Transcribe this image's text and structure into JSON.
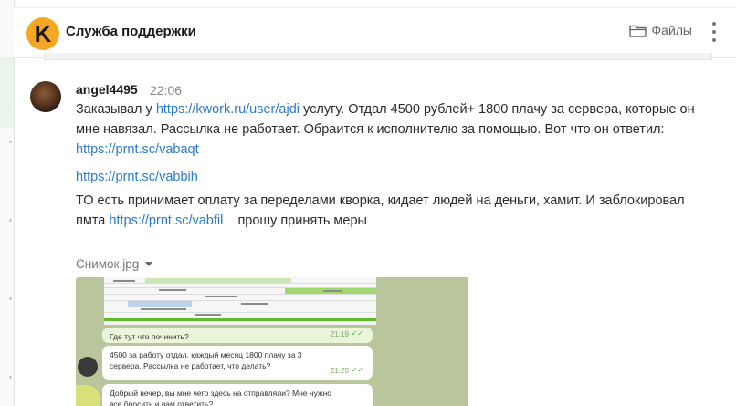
{
  "header": {
    "logo_letter": "K",
    "title": "Служба поддержки",
    "files_label": "Файлы",
    "files_icon": "folder-icon",
    "menu_icon": "more-vertical-icon"
  },
  "message": {
    "author": "angel4495",
    "time": "22:06",
    "line1_pre": "Заказывал у ",
    "line1_link": "https://kwork.ru/user/ajdi",
    "line1_post": "  услугу. Отдал 4500 рублей+ 1800 плачу за сервера, которые он мне навязал.  Рассылка не работает. Обраится к исполнителю за помощью. Вот что он ответил: ",
    "link1": "https://prnt.sc/vabaqt",
    "link2": "https://prnt.sc/vabbih",
    "para3_pre": "ТО есть принимает оплату за переделами кворка, кидает людей на деньги, хамит. И заблокировал пмта ",
    "para3_link": "https://prnt.sc/vabfil",
    "para3_post": "    прошу принять меры",
    "attachment_name": "Снимок.jpg"
  },
  "screenshot": {
    "bubble1_text": "Где тут что починить?",
    "bubble1_time": "21:19",
    "bubble2_text": "4500 за работу отдал. каждый месяц 1800 плачу за 3 сервера. Рассылка не работает, что делать?",
    "bubble2_time": "21:25",
    "bubble3_text": "Добрый вечер, вы мне чего здесь на отправляли? Мне нужно все бросить и вам ответить?",
    "check_mark": "✓✓"
  },
  "colors": {
    "logo": "#f5a623",
    "link": "#2a7bd0",
    "image_background": "#b9c69c"
  }
}
